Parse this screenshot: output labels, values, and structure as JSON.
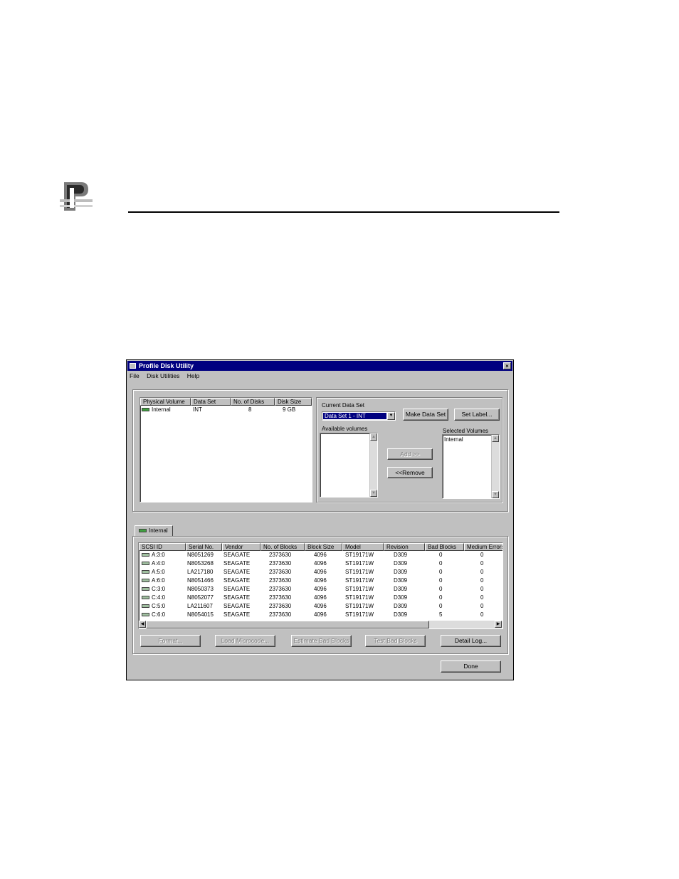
{
  "window": {
    "title": "Profile Disk Utility",
    "close_glyph": "×",
    "menu": [
      "File",
      "Disk Utilities",
      "Help"
    ]
  },
  "volumes_table": {
    "columns": [
      "Physical Volume",
      "Data Set",
      "No. of Disks",
      "Disk Size"
    ],
    "rows": [
      {
        "volume": "Internal",
        "data_set": "INT",
        "disks": "8",
        "size": "9 GB"
      }
    ]
  },
  "data_set": {
    "current_label": "Current Data Set",
    "current_value": "Data Set 1 - INT",
    "make_button": "Make Data Set",
    "set_label_button": "Set Label...",
    "available_label": "Available volumes",
    "available_items": [],
    "selected_label": "Selected Volumes",
    "selected_items": [
      "Internal"
    ],
    "add_button": "Add >>",
    "remove_button": "<<Remove"
  },
  "tab": {
    "label": "Internal"
  },
  "disks_table": {
    "columns": [
      "SCSI ID",
      "Serial No.",
      "Vendor",
      "No. of Blocks",
      "Block Size",
      "Model",
      "Revision",
      "Bad Blocks",
      "Medium Errors"
    ],
    "rows": [
      [
        "A:3:0",
        "N8051269",
        "SEAGATE",
        "2373630",
        "4096",
        "ST19171W",
        "D309",
        "0",
        "0"
      ],
      [
        "A:4:0",
        "N8053268",
        "SEAGATE",
        "2373630",
        "4096",
        "ST19171W",
        "D309",
        "0",
        "0"
      ],
      [
        "A:5:0",
        "LA217180",
        "SEAGATE",
        "2373630",
        "4096",
        "ST19171W",
        "D309",
        "0",
        "0"
      ],
      [
        "A:6:0",
        "N8051466",
        "SEAGATE",
        "2373630",
        "4096",
        "ST19171W",
        "D309",
        "0",
        "0"
      ],
      [
        "C:3:0",
        "N8050373",
        "SEAGATE",
        "2373630",
        "4096",
        "ST19171W",
        "D309",
        "0",
        "0"
      ],
      [
        "C:4:0",
        "N8052077",
        "SEAGATE",
        "2373630",
        "4096",
        "ST19171W",
        "D309",
        "0",
        "0"
      ],
      [
        "C:5:0",
        "LA211607",
        "SEAGATE",
        "2373630",
        "4096",
        "ST19171W",
        "D309",
        "0",
        "0"
      ],
      [
        "C:6:0",
        "N8054015",
        "SEAGATE",
        "2373630",
        "4096",
        "ST19171W",
        "D309",
        "5",
        "0"
      ]
    ]
  },
  "actions": {
    "format": "Format...",
    "load_microcode": "Load Microcode...",
    "estimate_bad_blocks": "Estimate Bad Blocks",
    "test_bad_blocks": "Test Bad Blocks",
    "detail_log": "Detail Log...",
    "done": "Done"
  }
}
